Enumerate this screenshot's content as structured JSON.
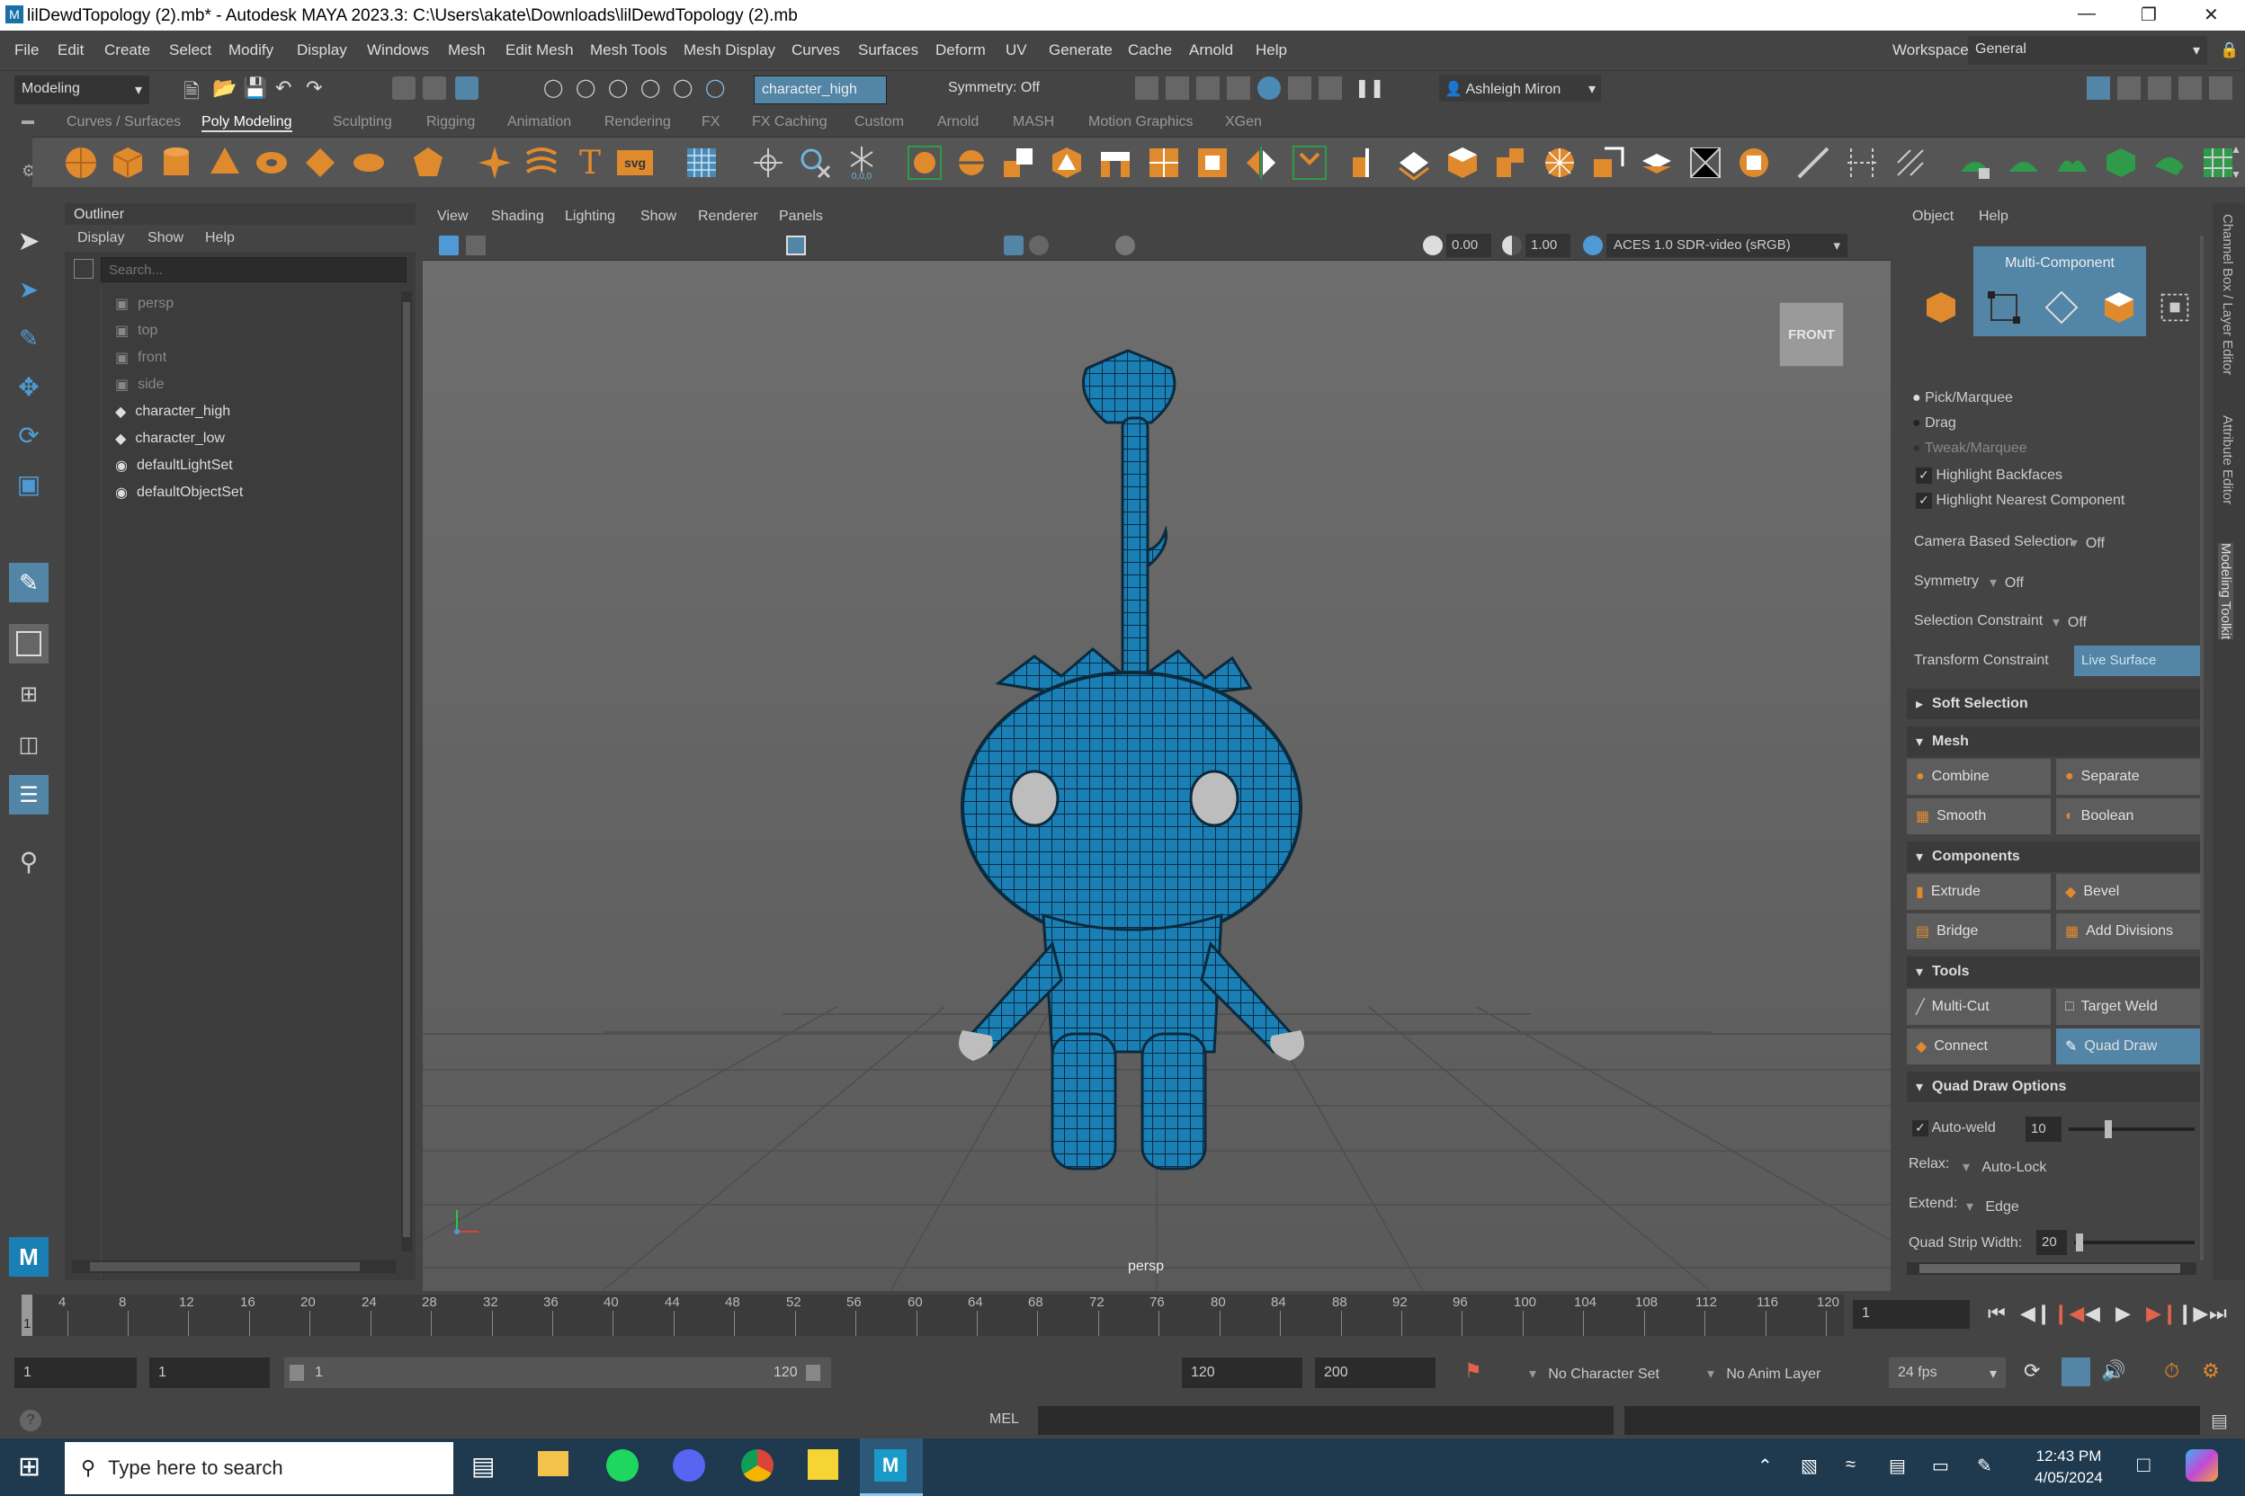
{
  "window": {
    "title": "lilDewdTopology (2).mb* - Autodesk MAYA 2023.3: C:\\Users\\akate\\Downloads\\lilDewdTopology (2).mb"
  },
  "menu": [
    "File",
    "Edit",
    "Create",
    "Select",
    "Modify",
    "Display",
    "Windows",
    "Mesh",
    "Edit Mesh",
    "Mesh Tools",
    "Mesh Display",
    "Curves",
    "Surfaces",
    "Deform",
    "UV",
    "Generate",
    "Cache",
    "Arnold",
    "Help"
  ],
  "workspace": {
    "label": "Workspace:",
    "value": "General"
  },
  "status": {
    "mode": "Modeling",
    "selection_field": "character_high",
    "symmetry": "Symmetry: Off",
    "user": "Ashleigh Miron"
  },
  "shelf_tabs": [
    "Curves / Surfaces",
    "Poly Modeling",
    "Sculpting",
    "Rigging",
    "Animation",
    "Rendering",
    "FX",
    "FX Caching",
    "Custom",
    "Arnold",
    "MASH",
    "Motion Graphics",
    "XGen"
  ],
  "shelf_active": "Poly Modeling",
  "outliner": {
    "title": "Outliner",
    "menu": [
      "Display",
      "Show",
      "Help"
    ],
    "search_placeholder": "Search...",
    "items": [
      {
        "label": "persp",
        "type": "camera"
      },
      {
        "label": "top",
        "type": "camera"
      },
      {
        "label": "front",
        "type": "camera"
      },
      {
        "label": "side",
        "type": "camera"
      },
      {
        "label": "character_high",
        "type": "mesh"
      },
      {
        "label": "character_low",
        "type": "mesh"
      },
      {
        "label": "defaultLightSet",
        "type": "set"
      },
      {
        "label": "defaultObjectSet",
        "type": "set"
      }
    ]
  },
  "viewport": {
    "menu": [
      "View",
      "Shading",
      "Lighting",
      "Show",
      "Renderer",
      "Panels"
    ],
    "exposure": "0.00",
    "gamma": "1.00",
    "colorspace": "ACES 1.0 SDR-video (sRGB)",
    "viewcube": "FRONT",
    "camera": "persp"
  },
  "toolkit": {
    "menu": [
      "Object",
      "Help"
    ],
    "mode": "Multi-Component",
    "select_modes": [
      "Pick/Marquee",
      "Drag",
      "Tweak/Marquee"
    ],
    "checks": [
      "Highlight Backfaces",
      "Highlight Nearest Component"
    ],
    "camera_based": {
      "label": "Camera Based Selection",
      "value": "Off"
    },
    "symmetry": {
      "label": "Symmetry",
      "value": "Off"
    },
    "selection_constraint": {
      "label": "Selection Constraint",
      "value": "Off"
    },
    "transform_constraint": {
      "label": "Transform Constraint",
      "value": "Live Surface"
    },
    "soft_selection": "Soft Selection",
    "mesh": {
      "title": "Mesh",
      "buttons": [
        "Combine",
        "Separate",
        "Smooth",
        "Boolean"
      ]
    },
    "components": {
      "title": "Components",
      "buttons": [
        "Extrude",
        "Bevel",
        "Bridge",
        "Add Divisions"
      ]
    },
    "tools": {
      "title": "Tools",
      "buttons": [
        "Multi-Cut",
        "Target Weld",
        "Connect",
        "Quad Draw"
      ]
    },
    "quad_draw": {
      "title": "Quad Draw Options",
      "autoweld_label": "Auto-weld",
      "autoweld_value": "10",
      "relax_label": "Relax:",
      "relax_value": "Auto-Lock",
      "extend_label": "Extend:",
      "extend_value": "Edge",
      "strip_label": "Quad Strip Width:",
      "strip_value": "20"
    }
  },
  "side_tabs": [
    "Channel Box / Layer Editor",
    "Attribute Editor",
    "Modeling Toolkit"
  ],
  "timeline": {
    "ticks": [
      "4",
      "8",
      "12",
      "16",
      "20",
      "24",
      "28",
      "32",
      "36",
      "40",
      "44",
      "48",
      "52",
      "56",
      "60",
      "64",
      "68",
      "72",
      "76",
      "80",
      "84",
      "88",
      "92",
      "96",
      "100",
      "104",
      "108",
      "112",
      "116",
      "120"
    ],
    "current": "1",
    "frame_field": "1"
  },
  "range": {
    "start": "1",
    "start2": "1",
    "slider_start": "1",
    "slider_end": "120",
    "end": "120",
    "end2": "200",
    "char_set": "No Character Set",
    "anim_layer": "No Anim Layer",
    "fps": "24 fps"
  },
  "cmdline": {
    "lang": "MEL"
  },
  "taskbar": {
    "search": "Type here to search",
    "time": "12:43 PM",
    "date": "4/05/2024"
  },
  "colors": {
    "accent": "#5285a6",
    "mesh": "#1a7fb5",
    "highlight": "#4f9ad4"
  }
}
